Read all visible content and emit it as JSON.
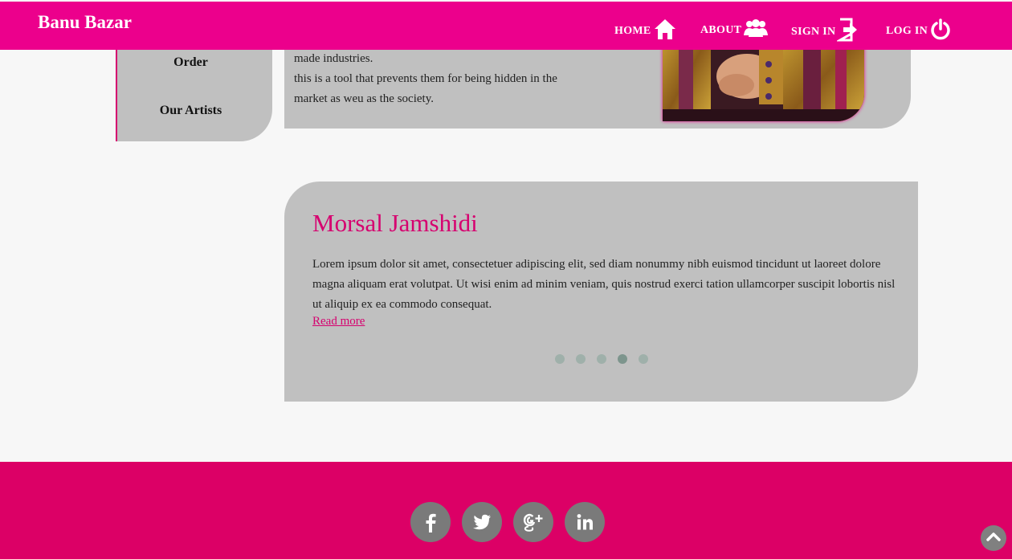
{
  "brand": {
    "name": "Banu Bazar"
  },
  "nav": [
    {
      "label": "HOME",
      "icon": "home-icon"
    },
    {
      "label": "ABOUT",
      "icon": "users-icon"
    },
    {
      "label": "SIGN IN",
      "icon": "sign-in-icon"
    },
    {
      "label": "LOG IN",
      "icon": "power-icon"
    }
  ],
  "sidebar": {
    "items": [
      {
        "label": "Order"
      },
      {
        "label": "Our Artists"
      }
    ]
  },
  "intro": {
    "lines": [
      "made industries.",
      "this is a tool that prevents them for being hidden in the",
      "market as weu as the society."
    ],
    "image": "embroidered-dress-photo"
  },
  "testimonial": {
    "name": "Morsal Jamshidi",
    "body": "Lorem ipsum dolor sit amet, consectetuer adipiscing elit, sed diam nonummy nibh euismod tincidunt ut laoreet dolore magna aliquam erat volutpat. Ut wisi enim ad minim veniam, quis nostrud exerci tation ullamcorper suscipit lobortis nisl ut aliquip ex ea commodo consequat.",
    "read_more": "Read more",
    "slide_count": 5,
    "active_slide": 4
  },
  "footer": {
    "social": [
      {
        "icon": "facebook-icon"
      },
      {
        "icon": "twitter-icon"
      },
      {
        "icon": "google-plus-icon"
      },
      {
        "icon": "linkedin-icon"
      }
    ]
  },
  "colors": {
    "primary": "#ec008c",
    "footer": "#dc0066",
    "card": "#c0c0c0",
    "background": "#f7f7f7",
    "accent_text": "#d6006f"
  },
  "scroll_top_icon": "chevron-up-icon"
}
